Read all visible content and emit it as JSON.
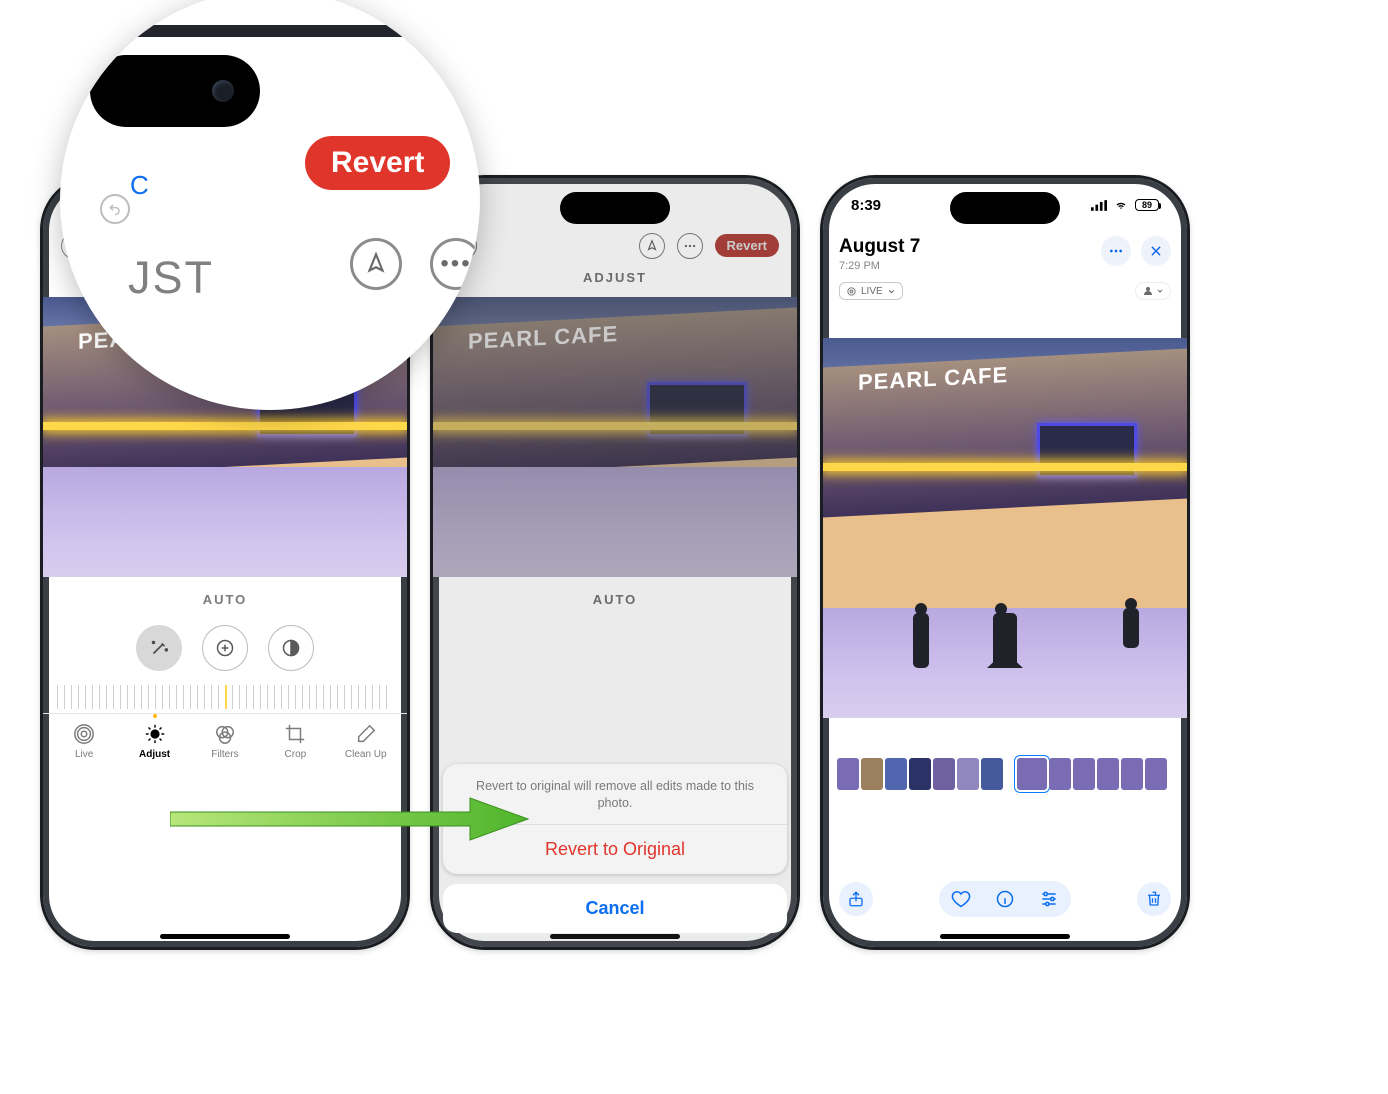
{
  "magnifier": {
    "revert_label": "Revert",
    "partial_adjust": "JST",
    "partial_cancel": "C"
  },
  "screen1": {
    "revert_label": "Revert",
    "adjust_label": "ADJUST",
    "auto_label": "AUTO",
    "photo_sign": "PEARL CAFE",
    "tabs": [
      {
        "id": "live",
        "label": "Live"
      },
      {
        "id": "adjust",
        "label": "Adjust"
      },
      {
        "id": "filters",
        "label": "Filters"
      },
      {
        "id": "crop",
        "label": "Crop"
      },
      {
        "id": "cleanup",
        "label": "Clean Up"
      }
    ]
  },
  "screen2": {
    "revert_label": "Revert",
    "adjust_label": "ADJUST",
    "auto_label": "AUTO",
    "photo_sign": "PEARL CAFE",
    "sheet_message": "Revert to original will remove all edits made to this photo.",
    "sheet_action": "Revert to Original",
    "sheet_cancel": "Cancel"
  },
  "screen3": {
    "status_time": "8:39",
    "battery": "89",
    "title": "August 7",
    "subtitle": "7:29 PM",
    "live_chip": "LIVE",
    "photo_sign": "PEARL CAFE"
  }
}
